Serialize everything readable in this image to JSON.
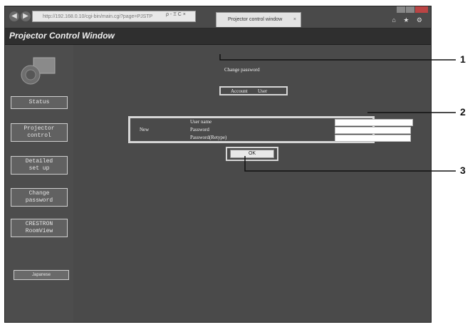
{
  "browser": {
    "address": "http://192.168.0.10/cgi-bin/main.cgi?page=PJSTP",
    "tab_title": "Projector control window",
    "tab_close": "×",
    "address_controls": "ρ - Ξ C ×",
    "right_icons": "⌂ ★ ⚙"
  },
  "page": {
    "title": "Projector Control Window"
  },
  "sidebar": {
    "items": [
      {
        "label": "Status"
      },
      {
        "label": "Projector\ncontrol"
      },
      {
        "label": "Detailed\nset up"
      },
      {
        "label": "Change\npassword"
      },
      {
        "label": "CRESTRON\nRoomView"
      }
    ],
    "language_button": "Japanese"
  },
  "content": {
    "heading": "Change password",
    "account": {
      "label": "Account",
      "value": "User"
    },
    "new_section": {
      "label": "New",
      "fields": [
        {
          "label": "User name",
          "value": ""
        },
        {
          "label": "Password",
          "value": ""
        },
        {
          "label": "Password(Retype)",
          "value": ""
        }
      ]
    },
    "ok_label": "OK"
  },
  "callouts": [
    "1",
    "2",
    "3"
  ]
}
